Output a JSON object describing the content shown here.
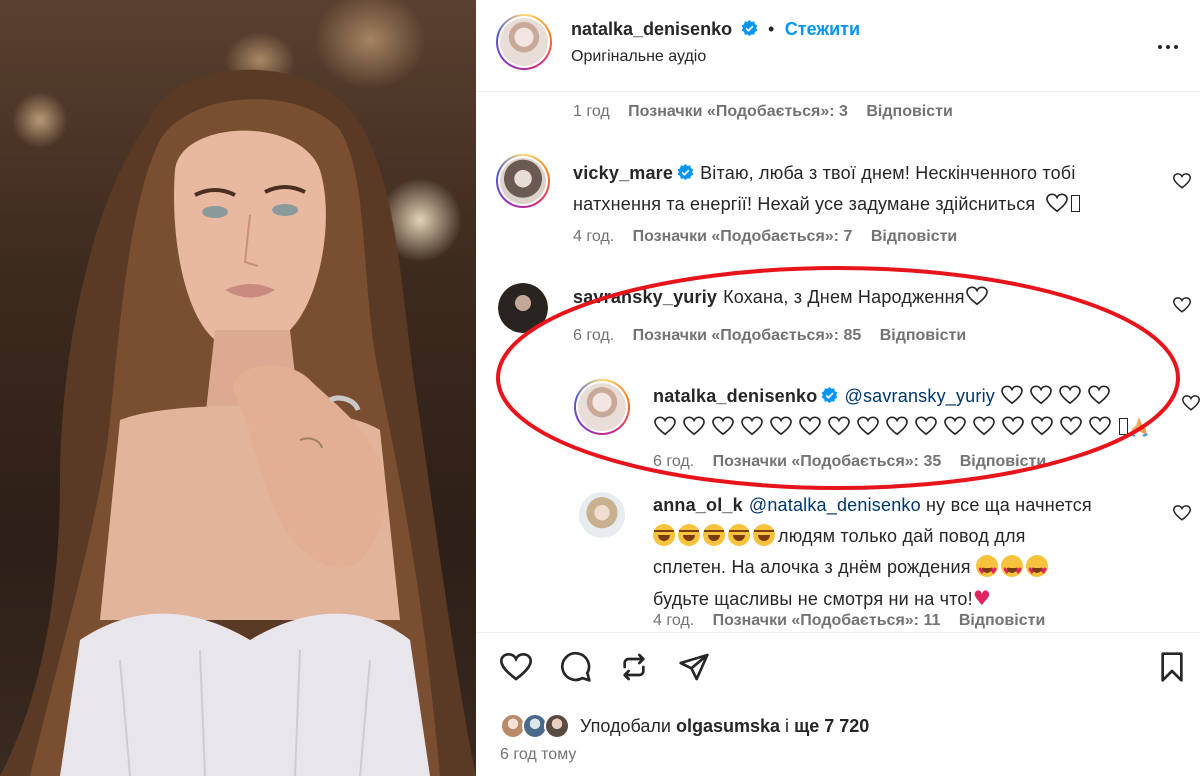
{
  "post": {
    "author": "natalka_denisenko",
    "follow_label": "Стежити",
    "audio_label": "Оригінальне аудіо",
    "more_icon": "more-horizontal-icon"
  },
  "top_meta": {
    "time": "1 год",
    "likes": "Позначки «Подобається»: 3",
    "reply": "Відповісти"
  },
  "comments": [
    {
      "user": "vicky_mare",
      "text_line1": "Вітаю, люба з твої днем! Нескінченного тобі",
      "text_line2": "натхнення та енергії! Нехай усе задумане здійсниться",
      "time": "4 год.",
      "likes": "Позначки «Подобається»: 7",
      "reply": "Відповісти"
    },
    {
      "user": "savransky_yuriy",
      "text": "Кохана, з Днем Народження",
      "time": "6 год.",
      "likes": "Позначки «Подобається»: 85",
      "reply": "Відповісти"
    }
  ],
  "replies": [
    {
      "user": "natalka_denisenko",
      "mention": "@savransky_yuriy",
      "time": "6 год.",
      "likes": "Позначки «Подобається»: 35",
      "reply": "Відповісти"
    },
    {
      "user": "anna_ol_k",
      "mention": "@natalka_denisenko",
      "text_line1": "ну все ща начнется",
      "text_line2": "людям только дай повод для",
      "text_line3": "сплетен. На алочка з днём рождения",
      "text_line4": "будьте щасливы не смотря ни на что!",
      "time": "4 год.",
      "likes": "Позначки «Подобається»: 11",
      "reply": "Відповісти"
    }
  ],
  "actions": {
    "liked_by_prefix": "Уподобали",
    "liked_by_user": "olgasumska",
    "liked_by_and": "і",
    "liked_by_count": "ще 7 720",
    "time_ago": "6 год тому"
  },
  "colors": {
    "accent": "#0095f6",
    "highlight_oval": "#e8141b",
    "text": "#262626",
    "muted": "#737373"
  }
}
